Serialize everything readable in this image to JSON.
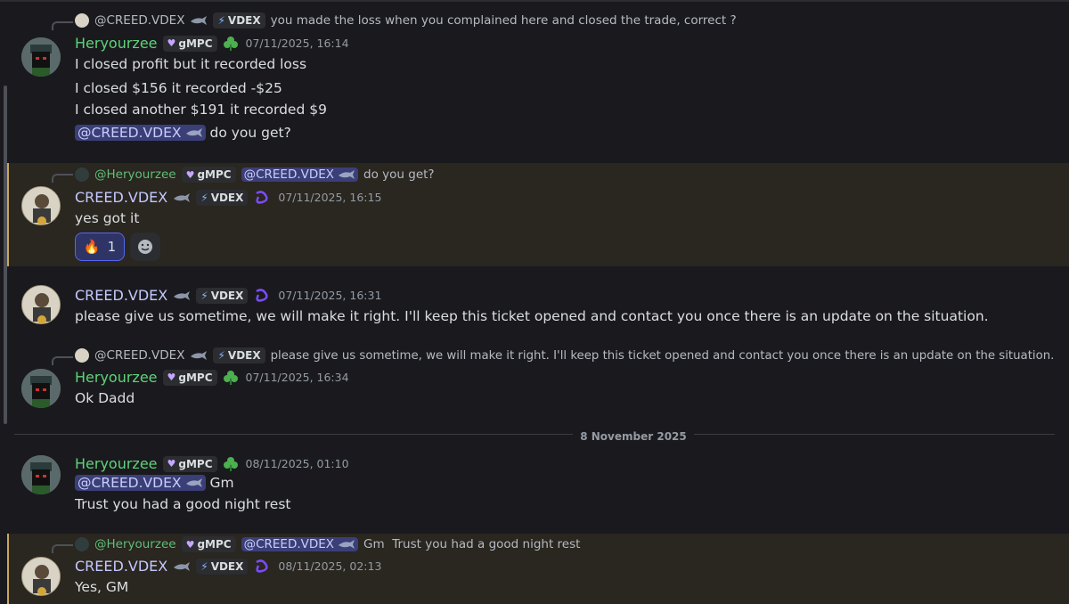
{
  "users": {
    "heryourzee": "Heryourzee",
    "creed": "CREED.VDEX",
    "creed_mention": "@CREED.VDEX",
    "heryourzee_mention": "@Heryourzee"
  },
  "tags": {
    "gmpc": "gMPC",
    "vdex": "VDEX"
  },
  "reply1": {
    "text": "you made the loss when you complained here and closed the trade, correct ?"
  },
  "msg1": {
    "timestamp": "07/11/2025, 16:14",
    "lines": [
      "I closed profit but it recorded loss",
      "I closed $156 it recorded -$25",
      "I closed another $191 it recorded $9"
    ],
    "last_suffix": "do you get?"
  },
  "reply2": {
    "text": "do you get?"
  },
  "msg2": {
    "timestamp": "07/11/2025, 16:15",
    "text": "yes got it",
    "reaction_emoji": "🔥",
    "reaction_count": "1"
  },
  "msg3": {
    "timestamp": "07/11/2025, 16:31",
    "text": "please give us sometime, we will make it right. I'll keep this ticket opened and contact you once there is an update on the situation."
  },
  "reply4": {
    "text": "please give us sometime, we will make it right. I'll keep this ticket opened and contact you once there is an update on the situation."
  },
  "msg4": {
    "timestamp": "07/11/2025, 16:34",
    "text": "Ok Dadd"
  },
  "date_divider": "8 November 2025",
  "msg5": {
    "timestamp": "08/11/2025, 01:10",
    "suffix": "Gm",
    "line2": "Trust you had a good night rest"
  },
  "reply6": {
    "text": "Gm  Trust you had a good night rest"
  },
  "msg6": {
    "timestamp": "08/11/2025, 02:13",
    "text": "Yes, GM"
  },
  "colors": {
    "accent": "#5865f2",
    "highlight_border": "#c9a65b",
    "heryourzee": "#5fd37a",
    "creed": "#c4c9ff"
  }
}
